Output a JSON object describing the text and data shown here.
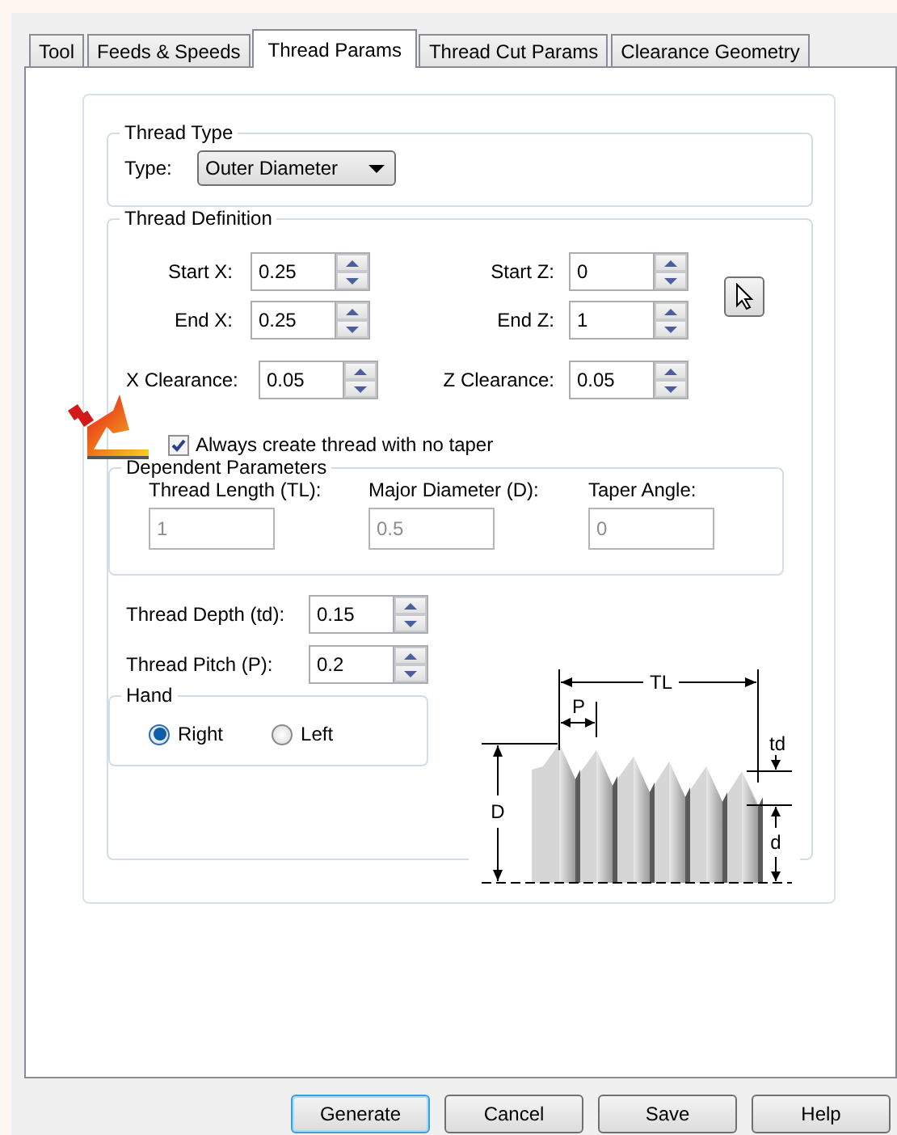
{
  "tabs": [
    {
      "label": "Tool",
      "selected": false
    },
    {
      "label": "Feeds & Speeds",
      "selected": false
    },
    {
      "label": "Thread Params",
      "selected": true
    },
    {
      "label": "Thread Cut Params",
      "selected": false
    },
    {
      "label": "Clearance Geometry",
      "selected": false
    }
  ],
  "thread_type": {
    "title": "Thread Type",
    "type_label": "Type:",
    "type_value": "Outer Diameter"
  },
  "thread_definition": {
    "title": "Thread Definition",
    "position_fields": [
      {
        "label": "Start X:",
        "value": "0.25"
      },
      {
        "label": "Start Z:",
        "value": "0"
      },
      {
        "label": "End X:",
        "value": "0.25"
      },
      {
        "label": "End Z:",
        "value": "1"
      }
    ],
    "clearance_fields": [
      {
        "label": "X Clearance:",
        "value": "0.05"
      },
      {
        "label": "Z Clearance:",
        "value": "0.05"
      }
    ],
    "no_taper": {
      "label": "Always create thread with no taper",
      "checked": true
    },
    "dependent_parameters": {
      "title": "Dependent Parameters",
      "fields": [
        {
          "label": "Thread Length (TL):",
          "value": "1",
          "disabled": true
        },
        {
          "label": "Major Diameter (D):",
          "value": "0.5",
          "disabled": true
        },
        {
          "label": "Taper Angle:",
          "value": "0",
          "disabled": true
        }
      ]
    },
    "thread_fields": [
      {
        "label": "Thread Depth (td):",
        "value": "0.15"
      },
      {
        "label": "Thread Pitch (P):",
        "value": "0.2"
      }
    ],
    "hand": {
      "title": "Hand",
      "options": [
        {
          "label": "Right",
          "selected": true
        },
        {
          "label": "Left",
          "selected": false
        }
      ]
    },
    "diagram": {
      "length_label": "TL",
      "pitch_label": "P",
      "depth_label": "td",
      "minor_label": "d",
      "diameter_label": "D"
    }
  },
  "buttons": [
    {
      "label": "Generate",
      "default": true
    },
    {
      "label": "Cancel",
      "default": false
    },
    {
      "label": "Save",
      "default": false
    },
    {
      "label": "Help",
      "default": false
    }
  ]
}
